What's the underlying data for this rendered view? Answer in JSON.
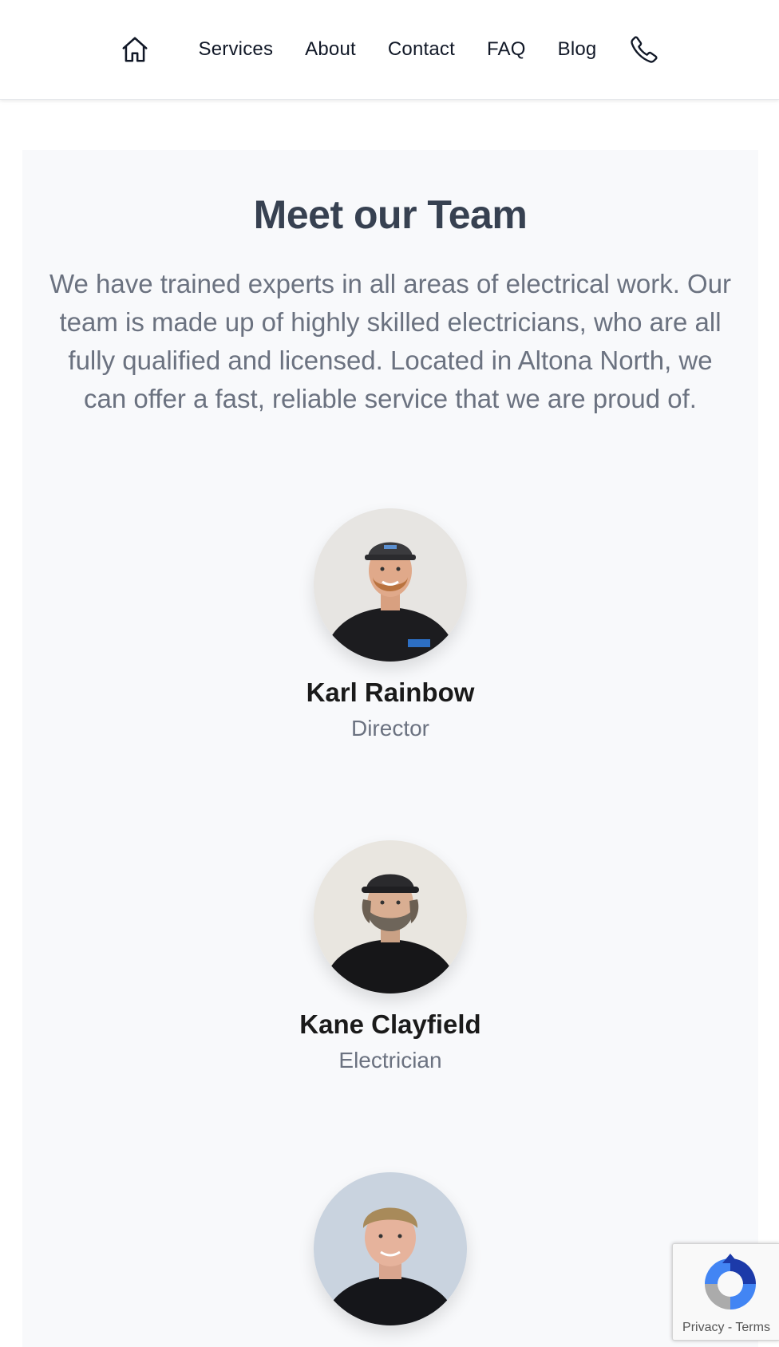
{
  "nav": {
    "home_icon": "home-icon",
    "links": [
      "Services",
      "About",
      "Contact",
      "FAQ",
      "Blog"
    ],
    "phone_icon": "phone-icon"
  },
  "team_section": {
    "title": "Meet our Team",
    "intro": "We have trained experts in all areas of electrical work. Our team is made up of highly skilled electricians, who are all fully qualified and licensed. Located in Altona North, we can offer a fast, reliable service that we are proud of.",
    "members": [
      {
        "name": "Karl Rainbow",
        "role": "Director"
      },
      {
        "name": "Kane Clayfield",
        "role": "Electrician"
      },
      {
        "name": "",
        "role": ""
      }
    ]
  },
  "recaptcha": {
    "privacy": "Privacy",
    "separator": "-",
    "terms": "Terms"
  },
  "colors": {
    "heading": "#374151",
    "body_text": "#6b7280",
    "section_bg": "#f8f9fb",
    "name_text": "#1a1a1a"
  }
}
